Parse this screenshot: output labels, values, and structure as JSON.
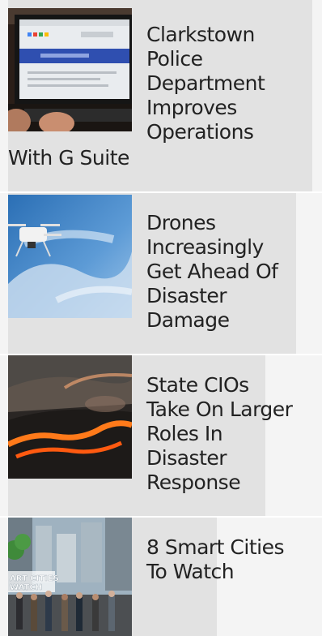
{
  "articles": [
    {
      "title_lines": [
        "Clarkstown",
        "Police",
        "Department",
        "Improves",
        "Operations"
      ],
      "title_tail": "With G Suite",
      "thumbnail": "computer-monitor-icon"
    },
    {
      "title_lines": [
        "Drones",
        "Increasingly",
        "Get Ahead Of",
        "Disaster",
        "Damage"
      ],
      "thumbnail": "drone-icon"
    },
    {
      "title_lines": [
        "State CIOs",
        "Take On Larger",
        "Roles In",
        "Disaster",
        "Response"
      ],
      "thumbnail": "lava-flow-icon"
    },
    {
      "title_lines": [
        "8 Smart Cities",
        "To Watch"
      ],
      "thumbnail": "city-street-icon",
      "thumbnail_overlay_text": [
        "ART CITIES",
        "WATCH"
      ]
    }
  ],
  "colors": {
    "card_background": "#e2e2e2",
    "page_background": "#f4f4f4",
    "text": "#222222"
  }
}
